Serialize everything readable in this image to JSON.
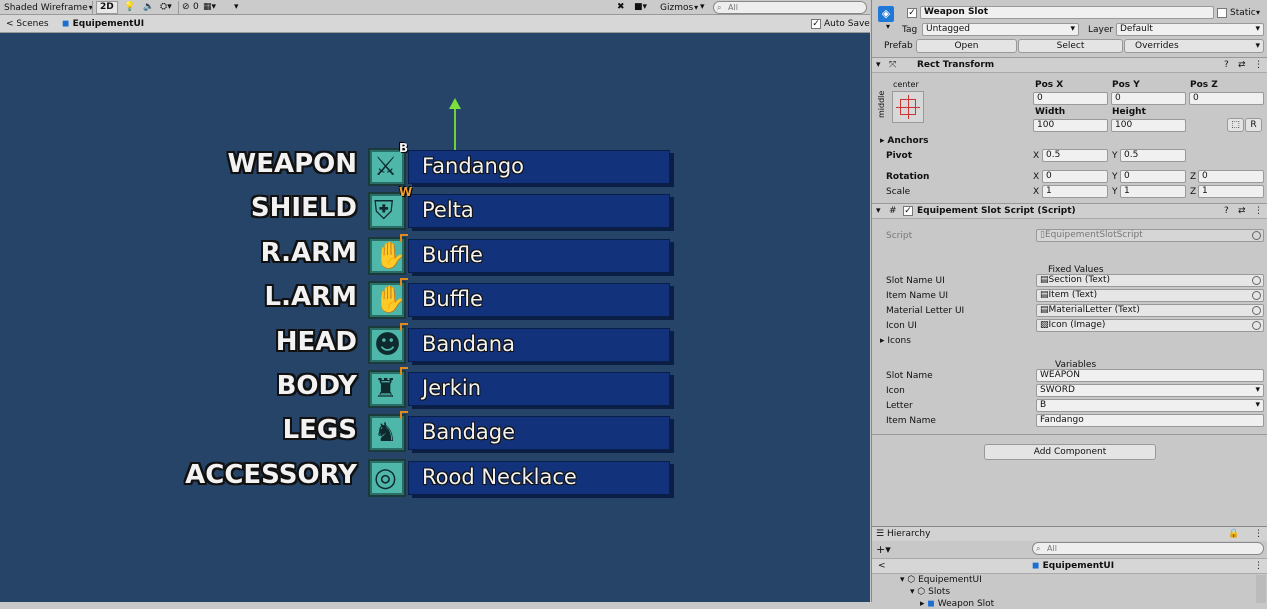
{
  "toolbar": {
    "shading_mode": "Shaded Wireframe",
    "mode_2d": "2D",
    "hidden_count": "0",
    "gizmos": "Gizmos",
    "search_placeholder": "All"
  },
  "scene_bar": {
    "scenes": "Scenes",
    "current": "EquipementUI",
    "auto_save": "Auto Save"
  },
  "slots": [
    {
      "name": "WEAPON",
      "item": "Fandango",
      "letter": "B",
      "icon": "sword-icon",
      "glyph": "⚔"
    },
    {
      "name": "SHIELD",
      "item": "Pelta",
      "letter": "W",
      "icon": "shield-icon",
      "glyph": "⛨"
    },
    {
      "name": "R.ARM",
      "item": "Buffle",
      "letter": "L",
      "icon": "arm-icon",
      "glyph": "✋"
    },
    {
      "name": "L.ARM",
      "item": "Buffle",
      "letter": "L",
      "icon": "arm-icon",
      "glyph": "✋"
    },
    {
      "name": "HEAD",
      "item": "Bandana",
      "letter": "L",
      "icon": "head-icon",
      "glyph": "☻"
    },
    {
      "name": "BODY",
      "item": "Jerkin",
      "letter": "L",
      "icon": "body-icon",
      "glyph": "♜"
    },
    {
      "name": "LEGS",
      "item": "Bandage",
      "letter": "L",
      "icon": "legs-icon",
      "glyph": "♞"
    },
    {
      "name": "ACCESSORY",
      "item": "Rood Necklace",
      "letter": "",
      "icon": "necklace-icon",
      "glyph": "◎"
    }
  ],
  "inspector": {
    "object_name": "Weapon Slot",
    "static_label": "Static",
    "tag_label": "Tag",
    "tag_value": "Untagged",
    "layer_label": "Layer",
    "layer_value": "Default",
    "prefab_label": "Prefab",
    "open": "Open",
    "select": "Select",
    "overrides": "Overrides",
    "rect_transform": {
      "title": "Rect Transform",
      "anchor_h": "center",
      "anchor_v": "middle",
      "pos_x_label": "Pos X",
      "pos_x": "0",
      "pos_y_label": "Pos Y",
      "pos_y": "0",
      "pos_z_label": "Pos Z",
      "pos_z": "0",
      "width_label": "Width",
      "width": "100",
      "height_label": "Height",
      "height": "100",
      "r_button": "R",
      "anchors": "Anchors",
      "pivot": "Pivot",
      "pivot_x": "0.5",
      "pivot_y": "0.5",
      "rotation": "Rotation",
      "rot_x": "0",
      "rot_y": "0",
      "rot_z": "0",
      "scale": "Scale",
      "scale_x": "1",
      "scale_y": "1",
      "scale_z": "1",
      "x": "X",
      "y": "Y",
      "z": "Z"
    },
    "script": {
      "title": "Equipement Slot Script (Script)",
      "script_label": "Script",
      "script_value": "EquipementSlotScript",
      "fixed_values": "Fixed Values",
      "slot_name_ui_label": "Slot Name UI",
      "slot_name_ui": "Section (Text)",
      "item_name_ui_label": "Item Name UI",
      "item_name_ui": "Item (Text)",
      "material_letter_ui_label": "Material Letter UI",
      "material_letter_ui": "MaterialLetter (Text)",
      "icon_ui_label": "Icon UI",
      "icon_ui": "Icon (Image)",
      "icons_label": "Icons",
      "variables": "Variables",
      "slot_name_label": "Slot Name",
      "slot_name": "WEAPON",
      "icon_label": "Icon",
      "icon": "SWORD",
      "letter_label": "Letter",
      "letter": "B",
      "item_name_label": "Item Name",
      "item_name": "Fandango"
    },
    "add_component": "Add Component"
  },
  "hierarchy": {
    "title": "Hierarchy",
    "search_placeholder": "All",
    "scene": "EquipementUI",
    "items": [
      "EquipementUI",
      "Slots",
      "Weapon Slot"
    ]
  }
}
